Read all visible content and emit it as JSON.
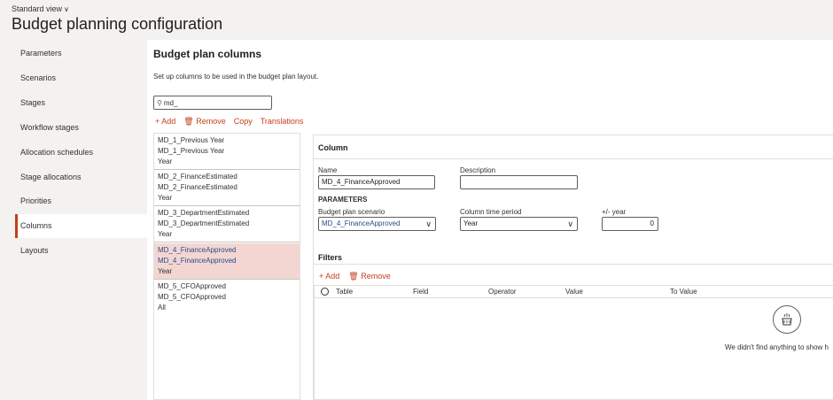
{
  "header": {
    "view_label": "Standard view",
    "title": "Budget planning configuration"
  },
  "nav": {
    "items": [
      {
        "label": "Parameters"
      },
      {
        "label": "Scenarios"
      },
      {
        "label": "Stages"
      },
      {
        "label": "Workflow stages"
      },
      {
        "label": "Allocation schedules"
      },
      {
        "label": "Stage allocations"
      },
      {
        "label": "Priorities"
      },
      {
        "label": "Columns"
      },
      {
        "label": "Layouts"
      }
    ],
    "active": "Columns"
  },
  "section": {
    "title": "Budget plan columns",
    "description": "Set up columns to be used in the budget plan layout."
  },
  "search": {
    "value": "md_"
  },
  "toolbar": {
    "add": "Add",
    "remove": "Remove",
    "copy": "Copy",
    "translations": "Translations"
  },
  "columns_list": [
    {
      "name": "MD_1_Previous Year",
      "description": "MD_1_Previous Year",
      "period": "Year"
    },
    {
      "name": "MD_2_FinanceEstimated",
      "description": "MD_2_FinanceEstimated",
      "period": "Year"
    },
    {
      "name": "MD_3_DepartmentEstimated",
      "description": "MD_3_DepartmentEstimated",
      "period": "Year"
    },
    {
      "name": "MD_4_FinanceApproved",
      "description": "MD_4_FinanceApproved",
      "period": "Year"
    },
    {
      "name": "MD_5_CFOApproved",
      "description": "MD_5_CFOApproved",
      "period": "All"
    }
  ],
  "detail": {
    "header": "Column",
    "name_label": "Name",
    "name_value": "MD_4_FinanceApproved",
    "description_label": "Description",
    "description_value": "",
    "parameters_label": "PARAMETERS",
    "scenario_label": "Budget plan scenario",
    "scenario_value": "MD_4_FinanceApproved",
    "period_label": "Column time period",
    "period_value": "Year",
    "year_label": "+/- year",
    "year_value": "0"
  },
  "filters": {
    "title": "Filters",
    "add": "Add",
    "remove": "Remove",
    "columns": [
      "Table",
      "Field",
      "Operator",
      "Value",
      "To Value"
    ],
    "empty_text": "We didn't find anything to show h"
  },
  "colors": {
    "accent": "#c43e1c",
    "selected_row": "#f3d6d2",
    "link_blue": "#2b4b8a"
  }
}
